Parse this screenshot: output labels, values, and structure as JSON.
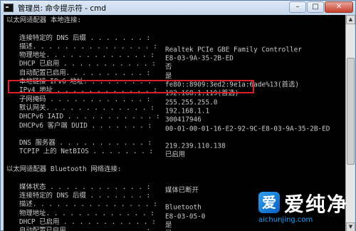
{
  "window": {
    "title": "管理员: 命令提示符 - cmd",
    "controls": {
      "minimize": "–",
      "maximize": "□",
      "close": "✕"
    }
  },
  "console": {
    "lines": [
      {
        "label": "以太网适配器 本地连接:",
        "value": "",
        "indent": false
      },
      {
        "label": "",
        "value": "",
        "indent": false
      },
      {
        "label": "连接特定的 DNS 后缀 . . . . . . . :",
        "value": "",
        "indent": true
      },
      {
        "label": "描述. . . . . . . . . . . . . . . :",
        "value": "Realtek PCIe GBE Family Controller",
        "indent": true
      },
      {
        "label": "物理地址. . . . . . . . . . . . . :",
        "value": "E8-03-9A-35-2B-ED",
        "indent": true
      },
      {
        "label": "DHCP 已启用 . . . . . . . . . . . :",
        "value": "否",
        "indent": true
      },
      {
        "label": "自动配置已启用. . . . . . . . . . :",
        "value": "是",
        "indent": true
      },
      {
        "label": "本地链接 IPv6 地址. . . . . . . . :",
        "value": "fe80::8909:3ed2:9e1a:6ade%13(首选)",
        "indent": true
      },
      {
        "label": "IPv4 地址 . . . . . . . . . . . . :",
        "value": "192.168.1.119(首选)",
        "indent": true
      },
      {
        "label": "子网掩码 . . . . . . . . . . . . :",
        "value": "255.255.255.0",
        "indent": true
      },
      {
        "label": "默认网关. . . . . . . . . . . . . :",
        "value": "192.168.1.1",
        "indent": true
      },
      {
        "label": "DHCPv6 IAID . . . . . . . . . . . :",
        "value": "300417946",
        "indent": true
      },
      {
        "label": "DHCPv6 客户端 DUID . . . . . . . :",
        "value": "00-01-00-01-16-E2-92-9C-E8-03-9A-35-2B-ED",
        "indent": true
      },
      {
        "label": "",
        "value": "",
        "indent": false
      },
      {
        "label": "DNS 服务器 . . . . . . . . . . . :",
        "value": "219.239.110.138",
        "indent": true
      },
      {
        "label": "TCPIP 上的 NetBIOS . . . . . . . :",
        "value": "已启用",
        "indent": true
      },
      {
        "label": "",
        "value": "",
        "indent": false
      },
      {
        "label": "以太网适配器 Bluetooth 网络连接:",
        "value": "",
        "indent": false
      },
      {
        "label": "",
        "value": "",
        "indent": false
      },
      {
        "label": "媒体状态 . . . . . . . . . . . . :",
        "value": "媒体已断开",
        "indent": true
      },
      {
        "label": "连接特定的 DNS 后缀 . . . . . . . :",
        "value": "",
        "indent": true
      },
      {
        "label": "描述. . . . . . . . . . . . . . . :",
        "value": "Bluetooth",
        "indent": true
      },
      {
        "label": "物理地址. . . . . . . . . . . . . :",
        "value": "E8-03-05-0",
        "indent": true
      },
      {
        "label": "DHCP 已启用 . . . . . . . . . . . :",
        "value": "是",
        "indent": true
      },
      {
        "label": "自动配置已启用. . . . . . . . . . :",
        "value": "是",
        "indent": true
      }
    ]
  },
  "watermark": {
    "logo_glyph": "爱",
    "text": "爱纯净",
    "url": "aichunjing.com"
  },
  "colors": {
    "highlight_border": "#d8202a",
    "console_bg": "#000000",
    "console_fg": "#c8c8c8"
  }
}
